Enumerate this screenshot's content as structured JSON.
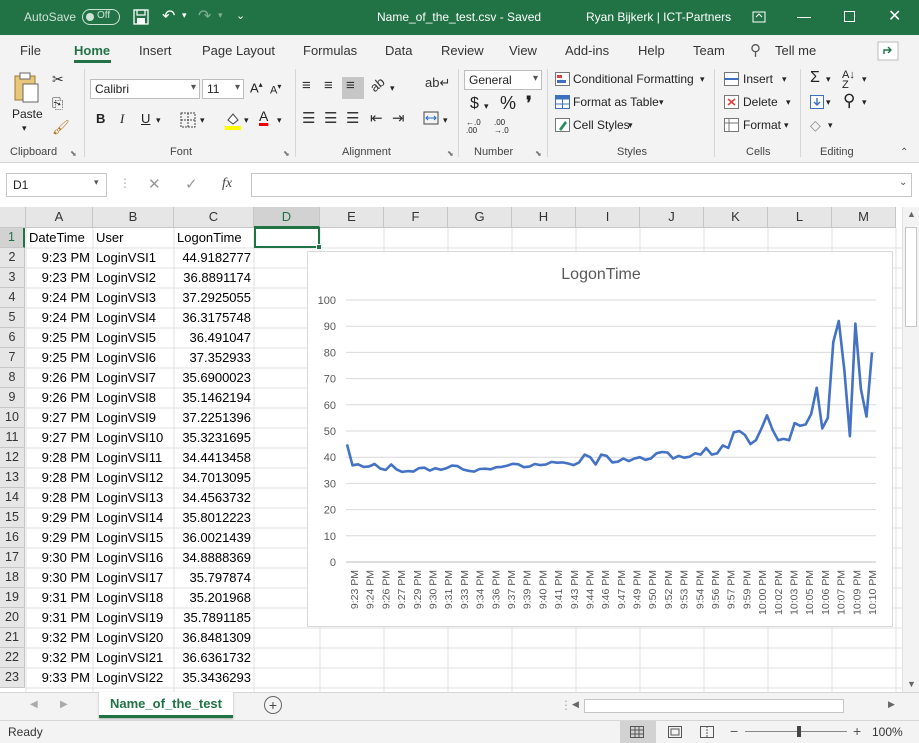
{
  "titlebar": {
    "autosave": "AutoSave",
    "autosave_state": "Off",
    "filename": "Name_of_the_test.csv  -  Saved",
    "user": "Ryan Bijkerk | ICT-Partners"
  },
  "tabs": [
    "File",
    "Home",
    "Insert",
    "Page Layout",
    "Formulas",
    "Data",
    "Review",
    "View",
    "Add-ins",
    "Help",
    "Team"
  ],
  "tell_me": "Tell me",
  "ribbon": {
    "paste": "Paste",
    "font_name": "Calibri",
    "font_size": "11",
    "number_format": "General",
    "conditional_formatting": "Conditional Formatting",
    "format_as_table": "Format as Table",
    "cell_styles": "Cell Styles",
    "insert": "Insert",
    "delete": "Delete",
    "format": "Format",
    "bold": "B",
    "italic": "I",
    "underline": "U",
    "groups": {
      "clipboard": "Clipboard",
      "font": "Font",
      "alignment": "Alignment",
      "number": "Number",
      "styles": "Styles",
      "cells": "Cells",
      "editing": "Editing"
    }
  },
  "formula_bar": {
    "name_box": "D1",
    "fx": "fx",
    "value": ""
  },
  "columns": [
    "A",
    "B",
    "C",
    "D",
    "E",
    "F",
    "G",
    "H",
    "I",
    "J",
    "K",
    "L",
    "M"
  ],
  "rows": [
    [
      "1",
      "DateTime",
      "User",
      "LogonTime"
    ],
    [
      "2",
      "9:23 PM",
      "LoginVSI1",
      "44.9182777"
    ],
    [
      "3",
      "9:23 PM",
      "LoginVSI2",
      "36.8891174"
    ],
    [
      "4",
      "9:24 PM",
      "LoginVSI3",
      "37.2925055"
    ],
    [
      "5",
      "9:24 PM",
      "LoginVSI4",
      "36.3175748"
    ],
    [
      "6",
      "9:25 PM",
      "LoginVSI5",
      "36.491047"
    ],
    [
      "7",
      "9:25 PM",
      "LoginVSI6",
      "37.352933"
    ],
    [
      "8",
      "9:26 PM",
      "LoginVSI7",
      "35.6900023"
    ],
    [
      "9",
      "9:26 PM",
      "LoginVSI8",
      "35.1462194"
    ],
    [
      "10",
      "9:27 PM",
      "LoginVSI9",
      "37.2251396"
    ],
    [
      "11",
      "9:27 PM",
      "LoginVSI10",
      "35.3231695"
    ],
    [
      "12",
      "9:28 PM",
      "LoginVSI11",
      "34.4413458"
    ],
    [
      "13",
      "9:28 PM",
      "LoginVSI12",
      "34.7013095"
    ],
    [
      "14",
      "9:28 PM",
      "LoginVSI13",
      "34.4563732"
    ],
    [
      "15",
      "9:29 PM",
      "LoginVSI14",
      "35.8012223"
    ],
    [
      "16",
      "9:29 PM",
      "LoginVSI15",
      "36.0021439"
    ],
    [
      "17",
      "9:30 PM",
      "LoginVSI16",
      "34.8888369"
    ],
    [
      "18",
      "9:30 PM",
      "LoginVSI17",
      "35.797874"
    ],
    [
      "19",
      "9:31 PM",
      "LoginVSI18",
      "35.201968"
    ],
    [
      "20",
      "9:31 PM",
      "LoginVSI19",
      "35.7891185"
    ],
    [
      "21",
      "9:32 PM",
      "LoginVSI20",
      "36.8481309"
    ],
    [
      "22",
      "9:32 PM",
      "LoginVSI21",
      "36.6361732"
    ],
    [
      "23",
      "9:33 PM",
      "LoginVSI22",
      "35.3436293"
    ]
  ],
  "chart_data": {
    "type": "line",
    "title": "LogonTime",
    "xlabel": "",
    "ylabel": "",
    "ylim": [
      0,
      100
    ],
    "yticks": [
      0,
      10,
      20,
      30,
      40,
      50,
      60,
      70,
      80,
      90,
      100
    ],
    "xtick_labels": [
      "9:23 PM",
      "9:24 PM",
      "9:26 PM",
      "9:27 PM",
      "9:29 PM",
      "9:30 PM",
      "9:31 PM",
      "9:33 PM",
      "9:34 PM",
      "9:36 PM",
      "9:37 PM",
      "9:39 PM",
      "9:40 PM",
      "9:41 PM",
      "9:43 PM",
      "9:44 PM",
      "9:46 PM",
      "9:47 PM",
      "9:49 PM",
      "9:50 PM",
      "9:52 PM",
      "9:53 PM",
      "9:54 PM",
      "9:56 PM",
      "9:57 PM",
      "9:59 PM",
      "10:00 PM",
      "10:02 PM",
      "10:03 PM",
      "10:05 PM",
      "10:06 PM",
      "10:07 PM",
      "10:09 PM",
      "10:10 PM"
    ],
    "series": [
      {
        "color": "#4472c4",
        "values": [
          44.9,
          36.9,
          37.3,
          36.3,
          36.5,
          37.4,
          35.7,
          35.1,
          37.2,
          35.3,
          34.4,
          34.7,
          34.5,
          35.8,
          36.0,
          34.9,
          35.8,
          35.2,
          35.8,
          36.8,
          36.6,
          35.3,
          34.8,
          34.5,
          35.5,
          35.6,
          35.4,
          36.2,
          36.3,
          36.8,
          37.5,
          37.3,
          36.2,
          36.4,
          37.4,
          37.0,
          37.2,
          38.2,
          37.9,
          38.0,
          37.6,
          37.0,
          38.0,
          41.0,
          40.0,
          37.2,
          41.0,
          40.5,
          38.0,
          38.3,
          39.5,
          38.5,
          39.5,
          40.0,
          39.0,
          39.5,
          41.5,
          42.0,
          41.8,
          39.5,
          40.5,
          39.8,
          40.2,
          41.5,
          41.0,
          43.5,
          41.0,
          41.5,
          44.5,
          43.5,
          49.5,
          50.0,
          48.5,
          45.0,
          46.5,
          51.0,
          56.0,
          50.5,
          46.5,
          47.0,
          46.5,
          53.0,
          52.0,
          52.5,
          56.5,
          66.5,
          51.0,
          55.0,
          84.0,
          92.0,
          73.0,
          48.0,
          91.0,
          66.0,
          55.5,
          80.0
        ]
      }
    ]
  },
  "sheet_tab": "Name_of_the_test",
  "status": {
    "ready": "Ready",
    "zoom": "100%"
  }
}
